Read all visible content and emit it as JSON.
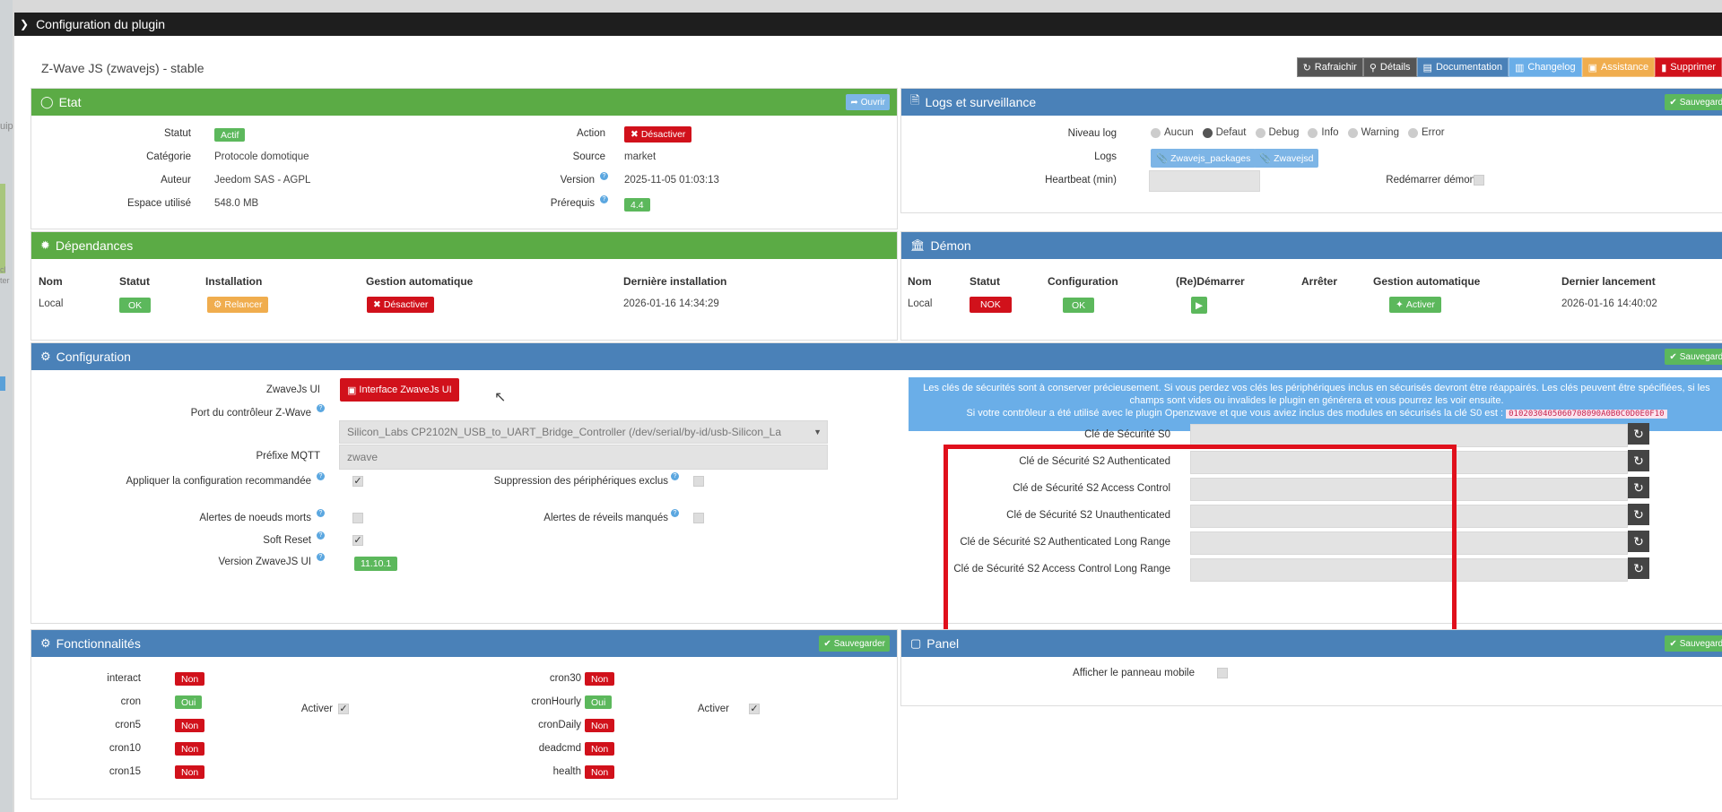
{
  "window": {
    "title": "Configuration du plugin"
  },
  "plugin_title": "Z-Wave JS (zwavejs) - stable",
  "toolbar": [
    {
      "label": "Rafraichir",
      "icon": "refresh-icon",
      "color": "#555555"
    },
    {
      "label": "Détails",
      "icon": "search-icon",
      "color": "#555555"
    },
    {
      "label": "Documentation",
      "icon": "book-icon",
      "color": "#4a81b8"
    },
    {
      "label": "Changelog",
      "icon": "file-icon",
      "color": "#6aaee8"
    },
    {
      "label": "Assistance",
      "icon": "truck-icon",
      "color": "#f0ad4e"
    },
    {
      "label": "Supprimer",
      "icon": "trash-icon",
      "color": "#d1111b"
    }
  ],
  "etat": {
    "title": "Etat",
    "open_btn": "Ouvrir",
    "statut_label": "Statut",
    "statut_value": "Actif",
    "categorie_label": "Catégorie",
    "categorie_value": "Protocole domotique",
    "auteur_label": "Auteur",
    "auteur_value": "Jeedom SAS - AGPL",
    "espace_label": "Espace utilisé",
    "espace_value": "548.0 MB",
    "action_label": "Action",
    "action_btn": "Désactiver",
    "source_label": "Source",
    "source_value": "market",
    "version_label": "Version",
    "version_value": "2025-11-05 01:03:13",
    "prerequis_label": "Prérequis",
    "prerequis_value": "4.4"
  },
  "logs": {
    "title": "Logs et surveillance",
    "save_btn": "Sauvegarder",
    "niveau_label": "Niveau log",
    "levels": [
      "Aucun",
      "Defaut",
      "Debug",
      "Info",
      "Warning",
      "Error"
    ],
    "logs_label": "Logs",
    "log_btn1": "Zwavejs_packages",
    "log_btn2": "Zwavejsd",
    "heartbeat_label": "Heartbeat (min)",
    "redemarrer_label": "Redémarrer démon"
  },
  "dependances": {
    "title": "Dépendances",
    "headers": {
      "nom": "Nom",
      "statut": "Statut",
      "installation": "Installation",
      "gestion": "Gestion automatique",
      "derniere": "Dernière installation"
    },
    "row": {
      "nom": "Local",
      "statut": "OK",
      "installation": "Relancer",
      "gestion": "Désactiver",
      "derniere": "2026-01-16 14:34:29"
    }
  },
  "demon": {
    "title": "Démon",
    "headers": {
      "nom": "Nom",
      "statut": "Statut",
      "configuration": "Configuration",
      "redemarrer": "(Re)Démarrer",
      "arreter": "Arrêter",
      "gestion": "Gestion automatique",
      "dernier": "Dernier lancement"
    },
    "row": {
      "nom": "Local",
      "statut": "NOK",
      "configuration": "OK",
      "gestion": "Activer",
      "dernier": "2026-01-16 14:40:02"
    }
  },
  "configuration": {
    "title": "Configuration",
    "save_btn": "Sauvegarder",
    "zwavejs_ui_label": "ZwaveJs UI",
    "zwavejs_ui_btn": "Interface ZwaveJs UI",
    "port_label": "Port du contrôleur Z-Wave",
    "port_value": "Silicon_Labs CP2102N_USB_to_UART_Bridge_Controller (/dev/serial/by-id/usb-Silicon_La",
    "prefixe_label": "Préfixe MQTT",
    "prefixe_value": "zwave",
    "appliquer_label": "Appliquer la configuration recommandée",
    "suppression_label": "Suppression des périphériques exclus",
    "alertes_morts_label": "Alertes de noeuds morts",
    "alertes_reveils_label": "Alertes de réveils manqués",
    "softreset_label": "Soft Reset",
    "version_ui_label": "Version ZwaveJS UI",
    "version_ui_value": "11.10.1",
    "info_text1": "Les clés de sécurités sont à conserver précieusement. Si vous perdez vos clés les périphériques inclus en sécurisés devront être réappairés. Les clés peuvent être spécifiées, si les champs sont vides ou invalides le plugin en générera et vous pourrez les voir ensuite.",
    "info_text2": "Si votre contrôleur a été utilisé avec le plugin Openzwave et que vous aviez inclus des modules en sécurisés la clé S0 est :",
    "info_code": "0102030405060708090A0B0C0D0E0F10",
    "keys": [
      "Clé de Sécurité S0",
      "Clé de Sécurité S2 Authenticated",
      "Clé de Sécurité S2 Access Control",
      "Clé de Sécurité S2 Unauthenticated",
      "Clé de Sécurité S2 Authenticated Long Range",
      "Clé de Sécurité S2 Access Control Long Range"
    ]
  },
  "fonctionnalites": {
    "title": "Fonctionnalités",
    "save_btn": "Sauvegarder",
    "activer_label": "Activer",
    "left": [
      {
        "name": "interact",
        "value": "Non"
      },
      {
        "name": "cron",
        "value": "Oui"
      },
      {
        "name": "cron5",
        "value": "Non"
      },
      {
        "name": "cron10",
        "value": "Non"
      },
      {
        "name": "cron15",
        "value": "Non"
      }
    ],
    "right": [
      {
        "name": "cron30",
        "value": "Non"
      },
      {
        "name": "cronHourly",
        "value": "Oui"
      },
      {
        "name": "cronDaily",
        "value": "Non"
      },
      {
        "name": "deadcmd",
        "value": "Non"
      },
      {
        "name": "health",
        "value": "Non"
      }
    ]
  },
  "panel": {
    "title": "Panel",
    "save_btn": "Sauvegarder",
    "afficher_label": "Afficher le panneau mobile"
  }
}
